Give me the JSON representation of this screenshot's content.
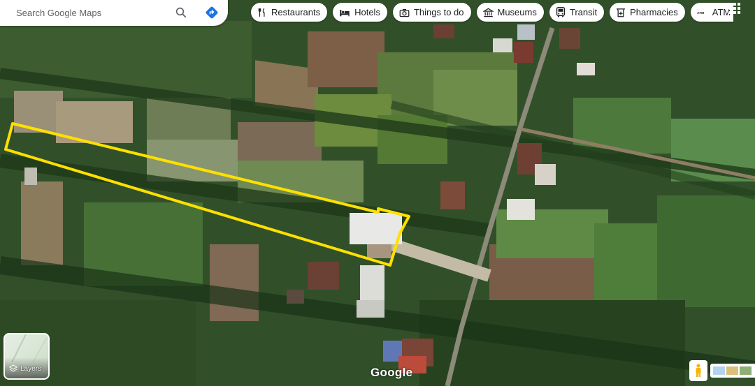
{
  "search": {
    "placeholder": "Search Google Maps"
  },
  "chips": [
    {
      "label": "Restaurants",
      "icon": "fork-knife-icon"
    },
    {
      "label": "Hotels",
      "icon": "bed-icon"
    },
    {
      "label": "Things to do",
      "icon": "camera-icon"
    },
    {
      "label": "Museums",
      "icon": "museum-icon"
    },
    {
      "label": "Transit",
      "icon": "bus-icon"
    },
    {
      "label": "Pharmacies",
      "icon": "pharmacy-icon"
    },
    {
      "label": "ATM",
      "icon": "atm-icon"
    }
  ],
  "layers": {
    "label": "Layers"
  },
  "logo": "Google",
  "colors": {
    "outline": "#ffe000",
    "directions": "#1a73e8",
    "accent_icon": "#5f6368"
  }
}
